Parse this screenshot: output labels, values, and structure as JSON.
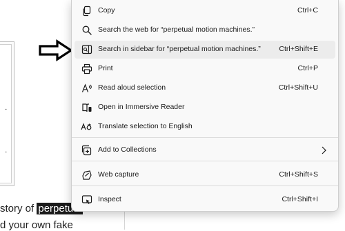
{
  "background": {
    "frame_ticks": [
      "-",
      "-"
    ],
    "text_line1_before": "story of ",
    "text_line1_highlight": "perpetual",
    "text_line2": "d your own fake"
  },
  "context_menu": {
    "items": [
      {
        "label": "Copy",
        "shortcut": "Ctrl+C",
        "icon": "copy-icon"
      },
      {
        "label": "Search the web for “perpetual motion machines.”",
        "shortcut": "",
        "icon": "search-icon"
      },
      {
        "label": "Search in sidebar for “perpetual motion machines.”",
        "shortcut": "Ctrl+Shift+E",
        "icon": "sidebar-search-icon",
        "highlighted": true
      },
      {
        "label": "Print",
        "shortcut": "Ctrl+P",
        "icon": "printer-icon"
      },
      {
        "label": "Read aloud selection",
        "shortcut": "Ctrl+Shift+U",
        "icon": "read-aloud-icon"
      },
      {
        "label": "Open in Immersive Reader",
        "shortcut": "",
        "icon": "immersive-reader-icon"
      },
      {
        "label": "Translate selection to English",
        "shortcut": "",
        "icon": "translate-icon"
      },
      {
        "label": "Add to Collections",
        "shortcut": "",
        "icon": "collections-icon",
        "submenu": true
      },
      {
        "label": "Web capture",
        "shortcut": "Ctrl+Shift+S",
        "icon": "web-capture-icon"
      },
      {
        "label": "Inspect",
        "shortcut": "Ctrl+Shift+I",
        "icon": "inspect-icon"
      }
    ]
  },
  "annotation": {
    "icon": "pointer-arrow-icon"
  }
}
